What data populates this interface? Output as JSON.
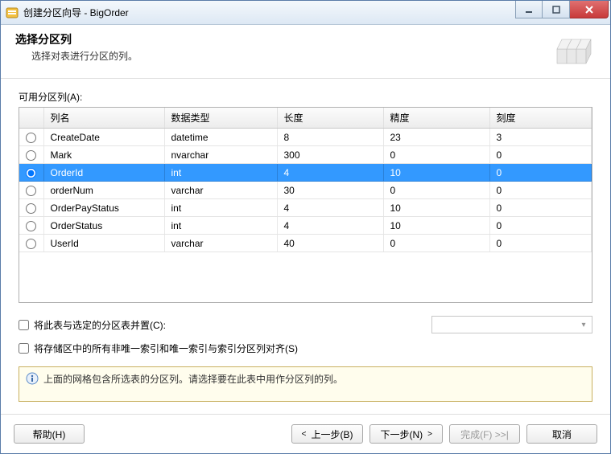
{
  "window": {
    "title": "创建分区向导 - BigOrder"
  },
  "header": {
    "title": "选择分区列",
    "subtitle": "选择对表进行分区的列。"
  },
  "section": {
    "available_label": "可用分区列(A):"
  },
  "table": {
    "headers": {
      "col0": "",
      "col1": "列名",
      "col2": "数据类型",
      "col3": "长度",
      "col4": "精度",
      "col5": "刻度"
    },
    "rows": [
      {
        "name": "CreateDate",
        "dtype": "datetime",
        "len": "8",
        "prec": "23",
        "scale": "3",
        "selected": false
      },
      {
        "name": "Mark",
        "dtype": "nvarchar",
        "len": "300",
        "prec": "0",
        "scale": "0",
        "selected": false
      },
      {
        "name": "OrderId",
        "dtype": "int",
        "len": "4",
        "prec": "10",
        "scale": "0",
        "selected": true
      },
      {
        "name": "orderNum",
        "dtype": "varchar",
        "len": "30",
        "prec": "0",
        "scale": "0",
        "selected": false
      },
      {
        "name": "OrderPayStatus",
        "dtype": "int",
        "len": "4",
        "prec": "10",
        "scale": "0",
        "selected": false
      },
      {
        "name": "OrderStatus",
        "dtype": "int",
        "len": "4",
        "prec": "10",
        "scale": "0",
        "selected": false
      },
      {
        "name": "UserId",
        "dtype": "varchar",
        "len": "40",
        "prec": "0",
        "scale": "0",
        "selected": false
      }
    ]
  },
  "options": {
    "collocate_label": "将此表与选定的分区表并置(C):",
    "collocate_selected": "",
    "align_indexes_label": "将存储区中的所有非唯一索引和唯一索引与索引分区列对齐(S)"
  },
  "info": {
    "message": "上面的网格包含所选表的分区列。请选择要在此表中用作分区列的列。"
  },
  "footer": {
    "help": "帮助(H)",
    "back": "上一步(B)",
    "next": "下一步(N)",
    "finish": "完成(F) >>|",
    "cancel": "取消"
  }
}
